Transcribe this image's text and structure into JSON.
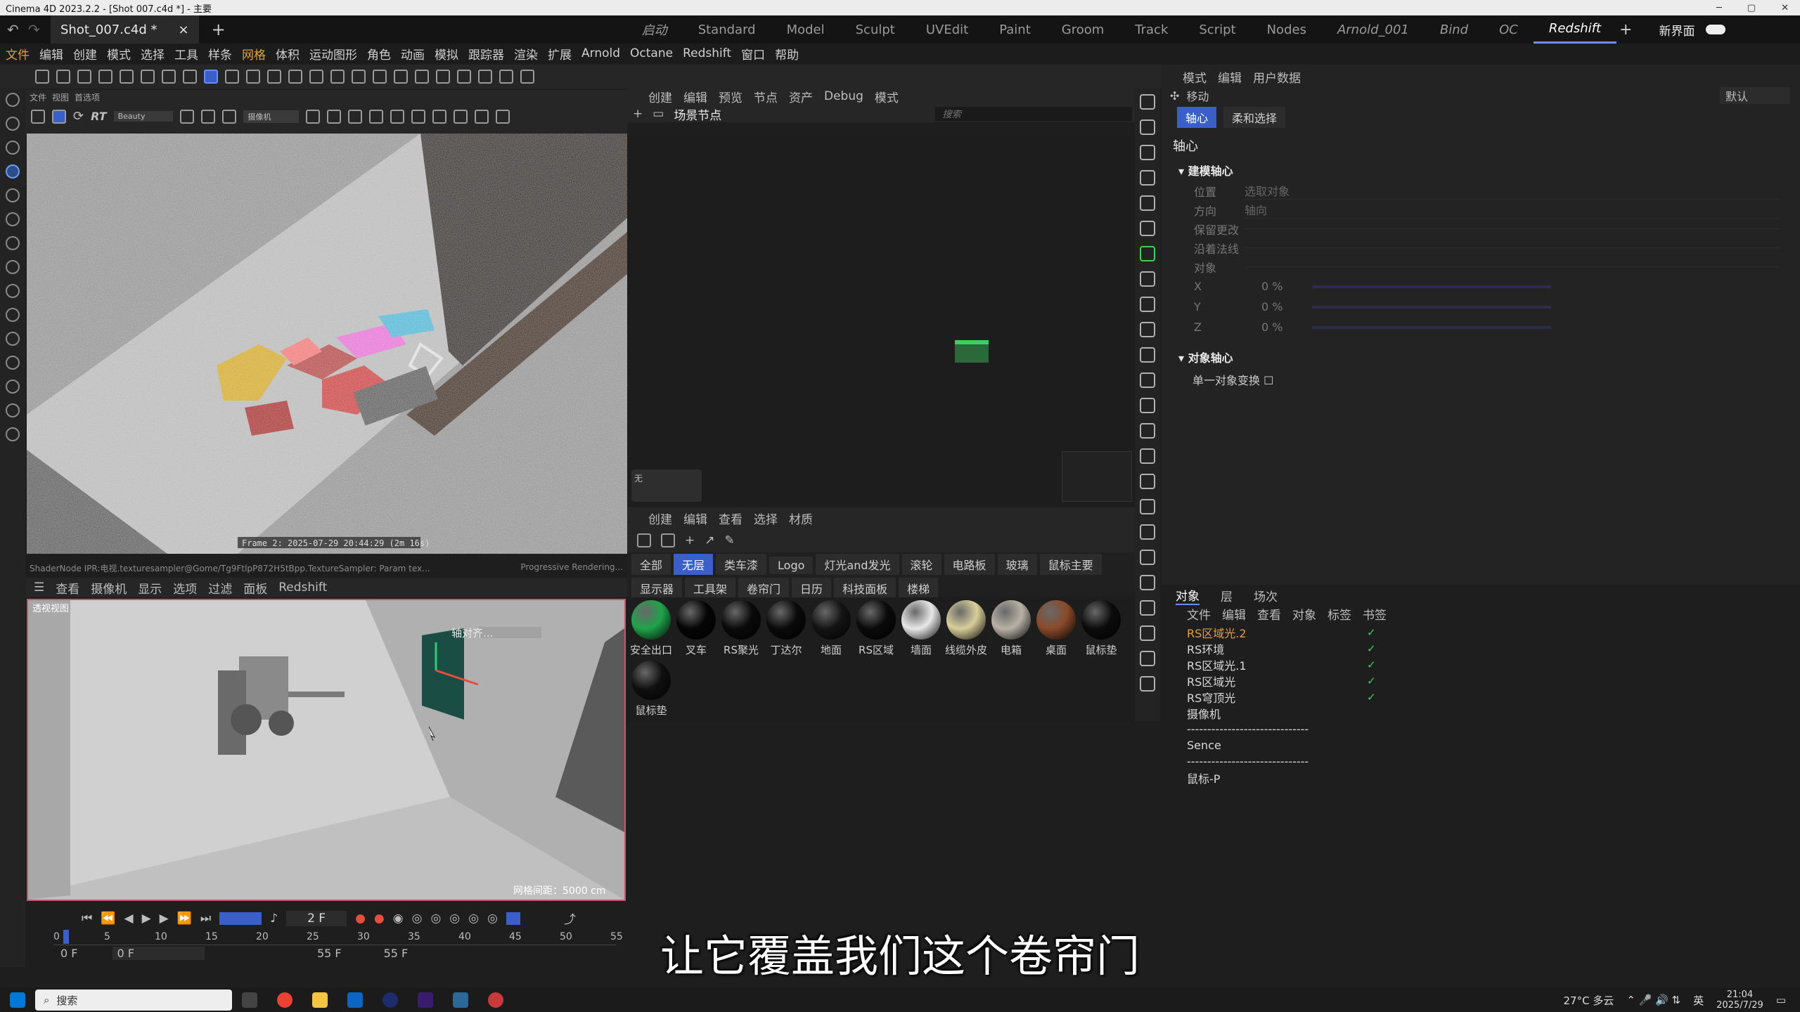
{
  "window": {
    "title": "Cinema 4D 2023.2.2 - [Shot 007.c4d *] - 主要"
  },
  "tabbar": {
    "doc_tab": "Shot_007.c4d *",
    "close": "×",
    "add": "+",
    "workspaces": [
      "启动",
      "Standard",
      "Model",
      "Sculpt",
      "UVEdit",
      "Paint",
      "Groom",
      "Track",
      "Script",
      "Nodes",
      "Arnold_001",
      "Bind",
      "OC",
      "Redshift"
    ],
    "active_workspace": "Redshift",
    "new_layout": "新界面"
  },
  "menubar": [
    "文件",
    "编辑",
    "创建",
    "模式",
    "选择",
    "工具",
    "样条",
    "网格",
    "体积",
    "运动图形",
    "角色",
    "动画",
    "模拟",
    "跟踪器",
    "渲染",
    "扩展",
    "Arnold",
    "Octane",
    "Redshift",
    "窗口",
    "帮助"
  ],
  "viewport_top": {
    "menu_small": [
      "文件",
      "视图",
      "首选项"
    ],
    "renderer_select": "Beauty",
    "camera_select": "摄像机",
    "frame_text": "Frame 2: 2025-07-29 20:44:29 (2m 16s)",
    "status_left": "ShaderNode IPR:电视.texturesampler@Gome/Tg9FtlpP872H5tBpp.TextureSampler: Param tex...",
    "status_right": "Progressive Rendering..."
  },
  "viewport_bottom": {
    "menu": [
      "查看",
      "摄像机",
      "显示",
      "选项",
      "过滤",
      "面板",
      "Redshift"
    ],
    "label": "透视视图",
    "axis_label": "轴对齐...",
    "grid_label": "网格间距：5000 cm"
  },
  "timeline": {
    "current_frame": "2 F",
    "ruler": [
      "0",
      "5",
      "10",
      "15",
      "20",
      "25",
      "30",
      "35",
      "40",
      "45",
      "50",
      "55"
    ],
    "start_field": "0 F",
    "start_field2": "0 F",
    "end_field": "55 F",
    "end_field2": "55 F"
  },
  "node_editor": {
    "menu": [
      "创建",
      "编辑",
      "预览",
      "节点",
      "资产",
      "Debug",
      "模式"
    ],
    "breadcrumb": "场景节点",
    "search_placeholder": "搜索",
    "small_label": "无"
  },
  "material_manager": {
    "menu": [
      "创建",
      "编辑",
      "查看",
      "选择",
      "材质"
    ],
    "filters_row1": [
      "全部",
      "无层",
      "类车漆",
      "Logo",
      "灯光and发光",
      "滚轮",
      "电路板",
      "玻璃",
      "鼠标主要"
    ],
    "active_filter": "无层",
    "filters_row2": [
      "显示器",
      "工具架",
      "卷帘门",
      "日历",
      "科技面板",
      "楼梯"
    ],
    "materials": [
      {
        "name": "安全出口",
        "color": "#1fa34a"
      },
      {
        "name": "叉车",
        "color": "#050505"
      },
      {
        "name": "RS聚光",
        "color": "#0a0a0a"
      },
      {
        "name": "丁达尔",
        "color": "#0a0a0a"
      },
      {
        "name": "地面",
        "color": "#141414"
      },
      {
        "name": "RS区域",
        "color": "#0a0a0a"
      },
      {
        "name": "墙面",
        "color": "#e8e8e8"
      },
      {
        "name": "线缆外皮",
        "color": "#d8cf9a"
      },
      {
        "name": "电箱",
        "color": "#b8b2a6"
      },
      {
        "name": "桌面",
        "color": "#8a4a2a"
      },
      {
        "name": "鼠标垫",
        "color": "#0c0c0c"
      },
      {
        "name": "鼠标垫",
        "color": "#101010"
      }
    ]
  },
  "attributes": {
    "menu": [
      "模式",
      "编辑",
      "用户数据"
    ],
    "tool_name": "移动",
    "preset": "默认",
    "tabs": [
      "轴心",
      "柔和选择"
    ],
    "active_tab": "轴心",
    "section_title": "轴心",
    "group1": "建模轴心",
    "fields": [
      {
        "label": "位置",
        "value": "选取对象"
      },
      {
        "label": "方向",
        "value": "轴向"
      },
      {
        "label": "保留更改",
        "value": ""
      },
      {
        "label": "沿着法线",
        "value": ""
      },
      {
        "label": "对象",
        "value": ""
      }
    ],
    "xyz": [
      {
        "label": "X",
        "value": "0 %"
      },
      {
        "label": "Y",
        "value": "0 %"
      },
      {
        "label": "Z",
        "value": "0 %"
      }
    ],
    "group2": "对象轴心",
    "single_transform": "单一对象变换"
  },
  "object_manager": {
    "tabs": [
      "对象",
      "层",
      "场次"
    ],
    "active_tab": "对象",
    "menu": [
      "文件",
      "编辑",
      "查看",
      "对象",
      "标签",
      "书签"
    ],
    "rows": [
      {
        "name": "RS区域光.2",
        "checked": true,
        "highlight": true
      },
      {
        "name": "RS环境",
        "checked": true,
        "highlight": false
      },
      {
        "name": "RS区域光.1",
        "checked": true,
        "highlight": false
      },
      {
        "name": "RS区域光",
        "checked": true,
        "highlight": false
      },
      {
        "name": "RS穹顶光",
        "checked": true,
        "highlight": false
      },
      {
        "name": "摄像机",
        "checked": false,
        "highlight": false
      },
      {
        "name": "------------------------------",
        "checked": false,
        "highlight": false
      },
      {
        "name": "Sence",
        "checked": false,
        "highlight": false
      },
      {
        "name": "------------------------------",
        "checked": false,
        "highlight": false
      },
      {
        "name": "鼠标-P",
        "checked": false,
        "highlight": false
      }
    ]
  },
  "subtitle": "让它覆盖我们这个卷帘门",
  "taskbar": {
    "search": "搜索",
    "weather": "27°C 多云",
    "ime": "英",
    "time": "21:04",
    "date": "2025/7/29"
  },
  "colors": {
    "accent": "#3a5fc8",
    "highlight": "#e0a040",
    "check": "#3fcf5e",
    "viewport_border": "#c8566e"
  }
}
